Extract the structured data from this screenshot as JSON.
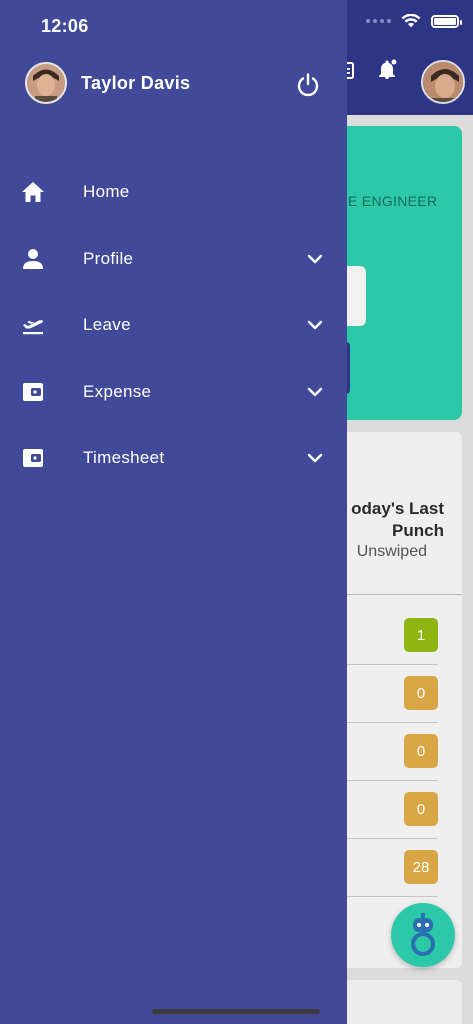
{
  "status_bar": {
    "time": "12:06"
  },
  "user": {
    "name": "Taylor Davis"
  },
  "menu": {
    "items": [
      {
        "label": "Home",
        "icon": "home-icon",
        "expandable": false
      },
      {
        "label": "Profile",
        "icon": "person-icon",
        "expandable": true
      },
      {
        "label": "Leave",
        "icon": "flight-takeoff-icon",
        "expandable": true
      },
      {
        "label": "Expense",
        "icon": "wallet-icon",
        "expandable": true
      },
      {
        "label": "Timesheet",
        "icon": "wallet-icon",
        "expandable": true
      }
    ]
  },
  "background": {
    "teal_card_text": "E ENGINEER",
    "punch_title": "oday's Last Punch",
    "punch_status": "Unswiped",
    "badges": [
      {
        "value": "1",
        "color": "#8fb512"
      },
      {
        "value": "0",
        "color": "#d9a645"
      },
      {
        "value": "0",
        "color": "#d9a645"
      },
      {
        "value": "0",
        "color": "#d9a645"
      },
      {
        "value": "28",
        "color": "#d9a645"
      }
    ]
  },
  "colors": {
    "drawer_bg": "#414a98",
    "header_bg": "#2d3585",
    "accent_teal": "#2cc9a8"
  }
}
